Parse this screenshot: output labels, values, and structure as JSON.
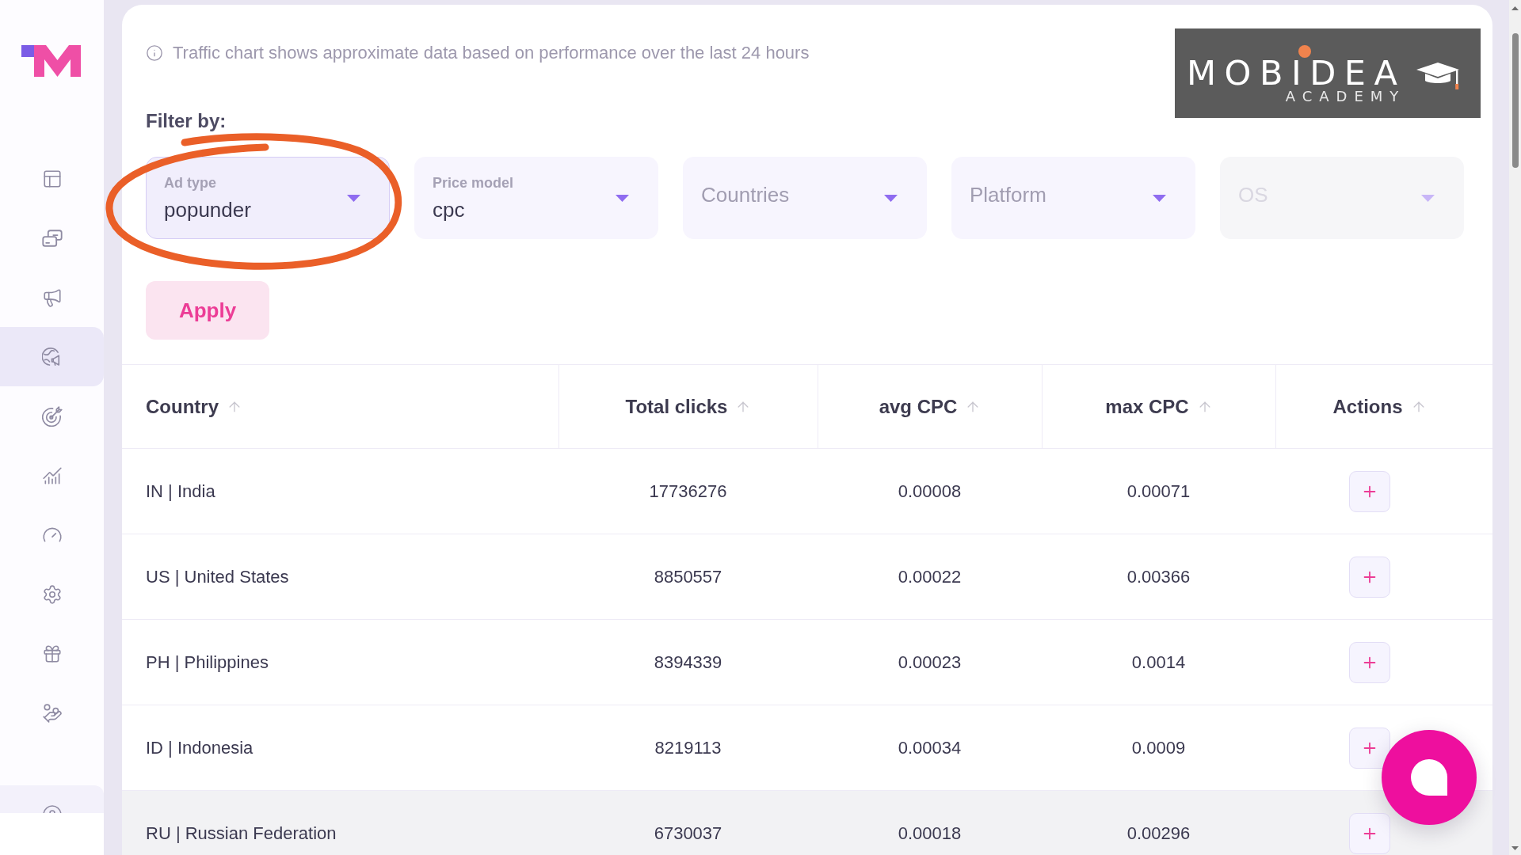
{
  "sidebar": {
    "items": [
      {
        "selected": false
      },
      {
        "selected": false
      },
      {
        "selected": false
      },
      {
        "selected": true
      },
      {
        "selected": false
      },
      {
        "selected": false
      },
      {
        "selected": false
      },
      {
        "selected": false
      },
      {
        "selected": false
      },
      {
        "selected": false
      }
    ]
  },
  "notice": {
    "text": "Traffic chart shows approximate data based on performance over the last 24 hours"
  },
  "logo": {
    "name": "MOBIDEA",
    "tagline": "ACADEMY"
  },
  "filters": {
    "title": "Filter by:",
    "fields": [
      {
        "label": "Ad type",
        "value": "popunder",
        "active": true,
        "disabled": false
      },
      {
        "label": "Price model",
        "value": "cpc",
        "active": false,
        "disabled": false
      },
      {
        "placeholder": "Countries",
        "active": false,
        "disabled": false
      },
      {
        "placeholder": "Platform",
        "active": false,
        "disabled": false
      },
      {
        "placeholder": "OS",
        "active": false,
        "disabled": true
      }
    ],
    "apply_button": "Apply"
  },
  "table": {
    "columns": [
      "Country",
      "Total clicks",
      "avg CPC",
      "max CPC",
      "Actions"
    ],
    "rows": [
      {
        "cells": [
          "IN | India",
          "17736276",
          "0.00008",
          "0.00071"
        ],
        "hovered": false
      },
      {
        "cells": [
          "US | United States",
          "8850557",
          "0.00022",
          "0.00366"
        ],
        "hovered": false
      },
      {
        "cells": [
          "PH | Philippines",
          "8394339",
          "0.00023",
          "0.0014"
        ],
        "hovered": false
      },
      {
        "cells": [
          "ID | Indonesia",
          "8219113",
          "0.00034",
          "0.0009"
        ],
        "hovered": false
      },
      {
        "cells": [
          "RU | Russian Federation",
          "6730037",
          "0.00018",
          "0.00296"
        ],
        "hovered": true
      }
    ]
  }
}
